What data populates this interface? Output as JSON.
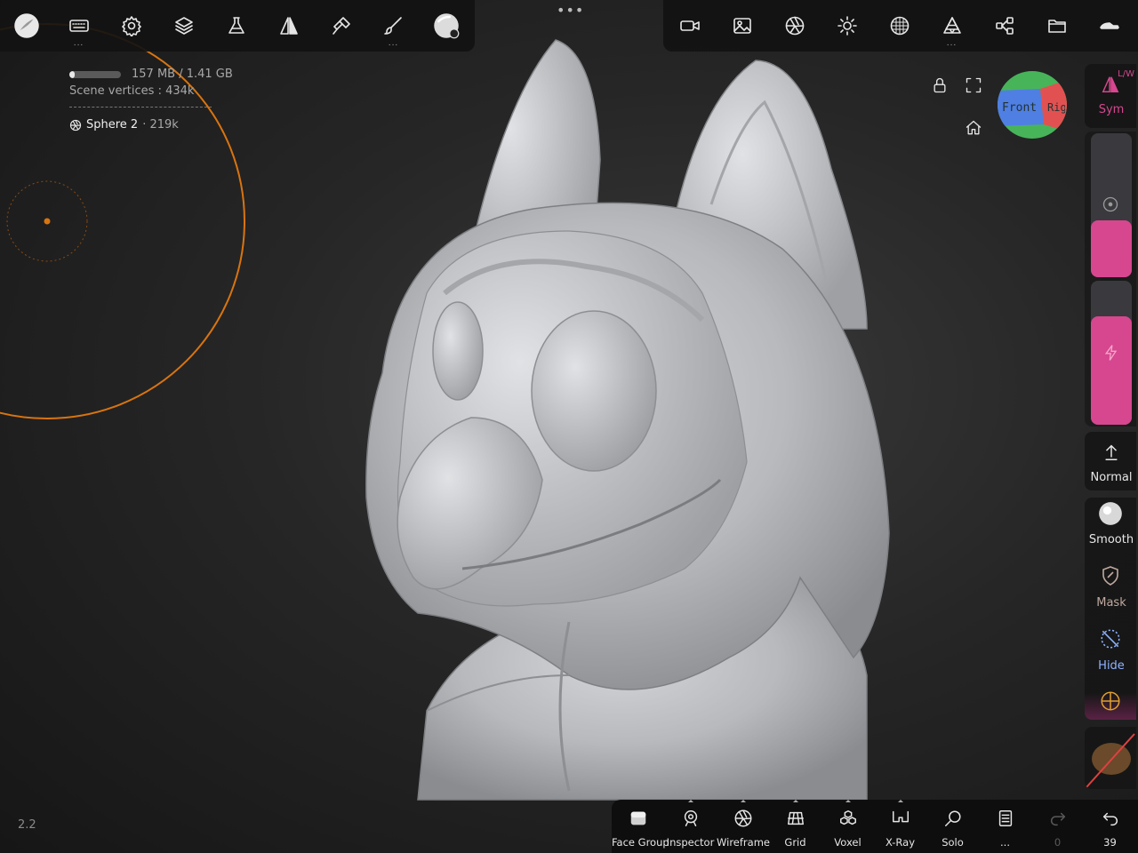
{
  "top_toolbar_left": {
    "items": [
      {
        "icon": "app-logo-icon"
      },
      {
        "icon": "keyboard-icon",
        "more": "..."
      },
      {
        "icon": "gear-icon"
      },
      {
        "icon": "layers-icon"
      },
      {
        "icon": "flask-icon"
      },
      {
        "icon": "symmetry-icon"
      },
      {
        "icon": "painter-icon"
      },
      {
        "icon": "brush-icon",
        "more": "..."
      },
      {
        "icon": "material-sphere-icon"
      }
    ]
  },
  "top_center": {
    "handle": "•••"
  },
  "top_toolbar_right": {
    "items": [
      {
        "icon": "camera-icon"
      },
      {
        "icon": "image-icon"
      },
      {
        "icon": "aperture-icon"
      },
      {
        "icon": "sun-icon"
      },
      {
        "icon": "dotted-sphere-icon"
      },
      {
        "icon": "topology-icon",
        "more": "..."
      },
      {
        "icon": "share-icon"
      },
      {
        "icon": "folder-icon"
      },
      {
        "icon": "car-icon"
      }
    ]
  },
  "stats": {
    "memory": "157 MB / 1.41 GB",
    "memory_fraction": 0.11,
    "vertices_label": "Scene vertices :",
    "vertices_value": "434k",
    "object_name": "Sphere 2",
    "object_count": "· 219k"
  },
  "view_cube": {
    "front": "Front",
    "right": "Right"
  },
  "right_panel": {
    "sym_label": "Sym",
    "lw_label": "L/W",
    "tools": [
      {
        "label": "Normal",
        "icon": "arrow-up-icon"
      },
      {
        "label": "Smooth",
        "icon": "smooth-sphere-icon"
      },
      {
        "label": "Mask",
        "icon": "mask-shield-icon"
      },
      {
        "label": "Hide",
        "icon": "hide-grid-icon"
      }
    ]
  },
  "bottom_toolbar": {
    "items": [
      {
        "label": "Face Group",
        "icon": "face-group-icon"
      },
      {
        "label": "Inspector",
        "icon": "inspector-eye-icon"
      },
      {
        "label": "Wireframe",
        "icon": "wireframe-icon"
      },
      {
        "label": "Grid",
        "icon": "grid-icon"
      },
      {
        "label": "Voxel",
        "icon": "voxel-icon"
      },
      {
        "label": "X-Ray",
        "icon": "xray-glasses-icon"
      },
      {
        "label": "Solo",
        "icon": "solo-search-icon"
      },
      {
        "label": "...",
        "icon": "book-icon"
      },
      {
        "label": "0",
        "icon": "redo-icon"
      },
      {
        "label": "39",
        "icon": "undo-icon"
      }
    ]
  },
  "version": "2.2",
  "colors": {
    "accent_pink": "#d6478f",
    "brush_ring": "#d9740f",
    "cube_red": "#e25151",
    "cube_green": "#47b45a",
    "cube_blue": "#4f7fe3"
  }
}
